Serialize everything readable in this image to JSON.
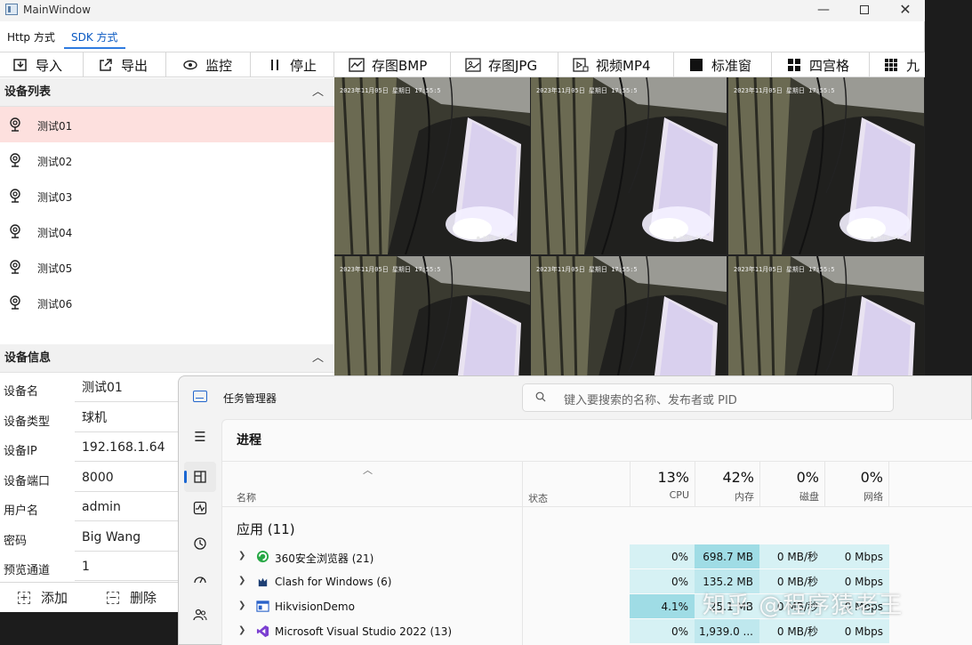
{
  "window": {
    "title": "MainWindow",
    "minimize": "—",
    "close": "✕"
  },
  "mode_tabs": [
    {
      "label": "Http 方式"
    },
    {
      "label": "SDK 方式"
    }
  ],
  "toolbar": [
    {
      "label": "导入",
      "icon": "import-icon"
    },
    {
      "label": "导出",
      "icon": "export-icon"
    },
    {
      "label": "监控",
      "icon": "eye-icon"
    },
    {
      "label": "停止",
      "icon": "pause-icon"
    },
    {
      "label": "存图BMP",
      "icon": "chart-icon"
    },
    {
      "label": "存图JPG",
      "icon": "image-icon"
    },
    {
      "label": "视频MP4",
      "icon": "video-icon"
    },
    {
      "label": "标准窗",
      "icon": "square-icon"
    },
    {
      "label": "四宫格",
      "icon": "grid4-icon"
    },
    {
      "label": "九",
      "icon": "grid9-icon"
    }
  ],
  "device_list": {
    "title": "设备列表",
    "items": [
      "测试01",
      "测试02",
      "测试03",
      "测试04",
      "测试05",
      "测试06"
    ],
    "selected_index": 0
  },
  "device_info": {
    "title": "设备信息",
    "rows": [
      {
        "key": "设备名",
        "value": "测试01"
      },
      {
        "key": "设备类型",
        "value": "球机"
      },
      {
        "key": "设备IP",
        "value": "192.168.1.64"
      },
      {
        "key": "设备端口",
        "value": "8000"
      },
      {
        "key": "用户名",
        "value": "admin"
      },
      {
        "key": "密码",
        "value": "Big Wang"
      },
      {
        "key": "预览通道",
        "value": "1"
      }
    ]
  },
  "buttons": {
    "add": "添加",
    "delete": "删除"
  },
  "video": {
    "timestamp": "2023年11月05日 星期日 17:55:5",
    "label": "● more 01"
  },
  "task_manager": {
    "title": "任务管理器",
    "search_placeholder": "键入要搜索的名称、发布者或 PID",
    "section": "进程",
    "columns": {
      "name": "名称",
      "status": "状态",
      "cpu": {
        "pct": "13%",
        "label": "CPU"
      },
      "mem": {
        "pct": "42%",
        "label": "内存"
      },
      "disk": {
        "pct": "0%",
        "label": "磁盘"
      },
      "net": {
        "pct": "0%",
        "label": "网络"
      }
    },
    "group": "应用 (11)",
    "processes": [
      {
        "name": "360安全浏览器 (21)",
        "cpu": "0%",
        "mem": "698.7 MB",
        "disk": "0 MB/秒",
        "net": "0 Mbps",
        "icon": "browser-360-icon",
        "mem_level": 0.9
      },
      {
        "name": "Clash for Windows (6)",
        "cpu": "0%",
        "mem": "135.2 MB",
        "disk": "0 MB/秒",
        "net": "0 Mbps",
        "icon": "clash-icon",
        "mem_level": 0.4
      },
      {
        "name": "HikvisionDemo",
        "cpu": "4.1%",
        "mem": "25.1 MB",
        "disk": "0 MB/秒",
        "net": "0 Mbps",
        "icon": "window-app-icon",
        "mem_level": 0.3
      },
      {
        "name": "Microsoft Visual Studio 2022 (13)",
        "cpu": "0%",
        "mem": "1,939.0 ...",
        "disk": "0 MB/秒",
        "net": "0 Mbps",
        "icon": "visual-studio-icon",
        "mem_level": 0.5
      }
    ]
  },
  "watermark": "知乎 @程序猿老王",
  "colors": {
    "selected_row": "#fde0de",
    "tab_accent": "#2f7be0",
    "heat_low": "#d6f1f4",
    "heat_mid": "#bfe8ee",
    "heat_high": "#9fdce5"
  }
}
